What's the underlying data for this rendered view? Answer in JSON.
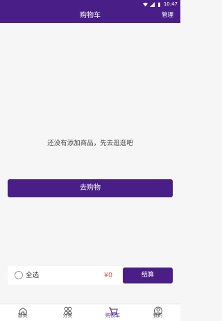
{
  "status_bar": {
    "time": "10:47"
  },
  "header": {
    "title": "购物车",
    "manage_label": "管理"
  },
  "empty_state": {
    "message": "还没有添加商品，先去逛逛吧",
    "go_shopping_label": "去购物"
  },
  "checkout": {
    "select_all_label": "全选",
    "total": "¥0",
    "pay_label": "结算"
  },
  "tabbar": {
    "items": [
      {
        "label": "首页",
        "icon": "home-icon"
      },
      {
        "label": "分类",
        "icon": "category-icon"
      },
      {
        "label": "购物车",
        "icon": "cart-icon",
        "active": true
      },
      {
        "label": "我的",
        "icon": "profile-icon"
      }
    ]
  },
  "colors": {
    "brand": "#4a1e87",
    "price": "#e54848",
    "background": "#f6f6f6"
  }
}
